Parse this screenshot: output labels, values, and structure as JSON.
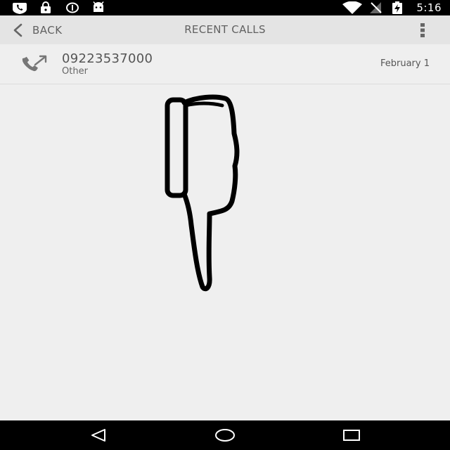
{
  "status_bar": {
    "time": "5:16",
    "left_icons": [
      "phone-notification-icon",
      "lock-icon",
      "info-circle-icon",
      "android-icon"
    ],
    "right_icons": [
      "wifi-icon",
      "no-signal-icon",
      "battery-charging-icon"
    ]
  },
  "action_bar": {
    "back_label": "BACK",
    "title": "RECENT CALLS",
    "back_icon": "chevron-left-icon",
    "overflow_icon": "overflow-menu-icon"
  },
  "recent_calls": [
    {
      "number": "09223537000",
      "type": "Other",
      "date": "February 1",
      "icon": "outgoing-call-icon"
    }
  ],
  "nav_bar": {
    "icons": [
      "back-triangle-icon",
      "home-circle-icon",
      "recents-square-icon"
    ]
  },
  "colors": {
    "status_bar_bg": "#000000",
    "action_bar_bg": "#e4e4e4",
    "screen_bg": "#efefef",
    "text_gray": "#616161",
    "drawing_stroke": "#000000"
  }
}
